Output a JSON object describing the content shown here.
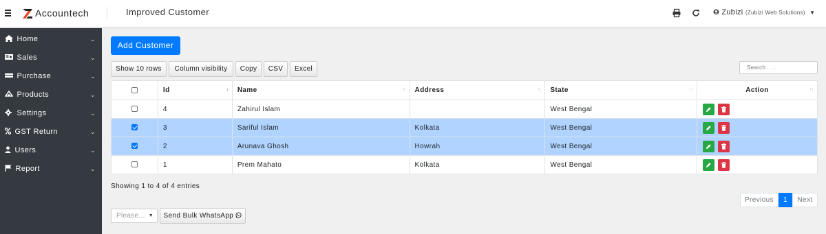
{
  "app": {
    "brand": "Accountech",
    "page_title": "Improved Customer"
  },
  "header": {
    "user_name": "Zubizi",
    "user_org": "(Zubizi Web Solutions)"
  },
  "sidebar": {
    "items": [
      {
        "label": "Home",
        "icon": "home-icon"
      },
      {
        "label": "Sales",
        "icon": "money-icon"
      },
      {
        "label": "Purchase",
        "icon": "cart-icon"
      },
      {
        "label": "Products",
        "icon": "cubes-icon"
      },
      {
        "label": "Settings",
        "icon": "gear-icon"
      },
      {
        "label": "GST Return",
        "icon": "percent-icon"
      },
      {
        "label": "Users",
        "icon": "user-icon"
      },
      {
        "label": "Report",
        "icon": "flag-icon"
      }
    ]
  },
  "main": {
    "add_button": "Add Customer",
    "toolbar": {
      "show_rows": "Show 10 rows",
      "column_visibility": "Column visibility",
      "copy": "Copy",
      "csv": "CSV",
      "excel": "Excel"
    },
    "search_placeholder": "Search . . .",
    "table": {
      "columns": [
        "Id",
        "Name",
        "Address",
        "State",
        "Action"
      ],
      "rows": [
        {
          "id": "4",
          "name": "Zahirul Islam",
          "address": "",
          "state": "West Bengal",
          "selected": false
        },
        {
          "id": "3",
          "name": "Sariful Islam",
          "address": "Kolkata",
          "state": "West Bengal",
          "selected": true
        },
        {
          "id": "2",
          "name": "Arunava Ghosh",
          "address": "Howrah",
          "state": "West Bengal",
          "selected": true
        },
        {
          "id": "1",
          "name": "Prem Mahato",
          "address": "Kolkata",
          "state": "West Bengal",
          "selected": false
        }
      ]
    },
    "info": "Showing 1 to 4 of 4 entries",
    "pagination": {
      "previous": "Previous",
      "current": "1",
      "next": "Next"
    },
    "bulk": {
      "select_placeholder": "Please...",
      "send_button": "Send Bulk WhatsApp"
    }
  },
  "colors": {
    "primary": "#007bff",
    "sidebar": "#343a40",
    "selected_row": "#b0d4ff",
    "edit": "#28a745",
    "delete": "#dc3545"
  }
}
